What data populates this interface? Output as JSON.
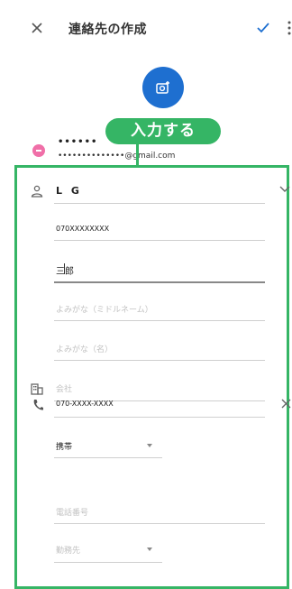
{
  "header": {
    "title": "連絡先の作成",
    "close_icon": "close-icon",
    "save_icon": "check-icon",
    "more_icon": "more-vert-icon"
  },
  "photo": {
    "icon": "add-photo-icon",
    "color": "#1e6fd0"
  },
  "account": {
    "name_masked": "••••••",
    "email": "••••••••••••••@gmail.com",
    "avatar_color": "#f06fa8"
  },
  "callout": {
    "label": "入力する",
    "color": "#35b565"
  },
  "name_section": {
    "icon": "person-icon",
    "name_value": "L G",
    "expand_icon": "chevron-down-icon",
    "fields": [
      {
        "value": "070XXXXXXXX",
        "placeholder": ""
      },
      {
        "value": "三郎",
        "placeholder": ""
      },
      {
        "value": "",
        "placeholder": "よみがな（ミドルネーム）"
      },
      {
        "value": "",
        "placeholder": "よみがな（名）"
      }
    ]
  },
  "company": {
    "icon": "business-icon",
    "placeholder": "会社"
  },
  "phone": {
    "icon": "phone-icon",
    "value": "070-XXXX-XXXX",
    "clear_icon": "close-icon",
    "type_value": "携帯",
    "placeholder2": "電話番号",
    "type2_placeholder": "勤務先"
  }
}
